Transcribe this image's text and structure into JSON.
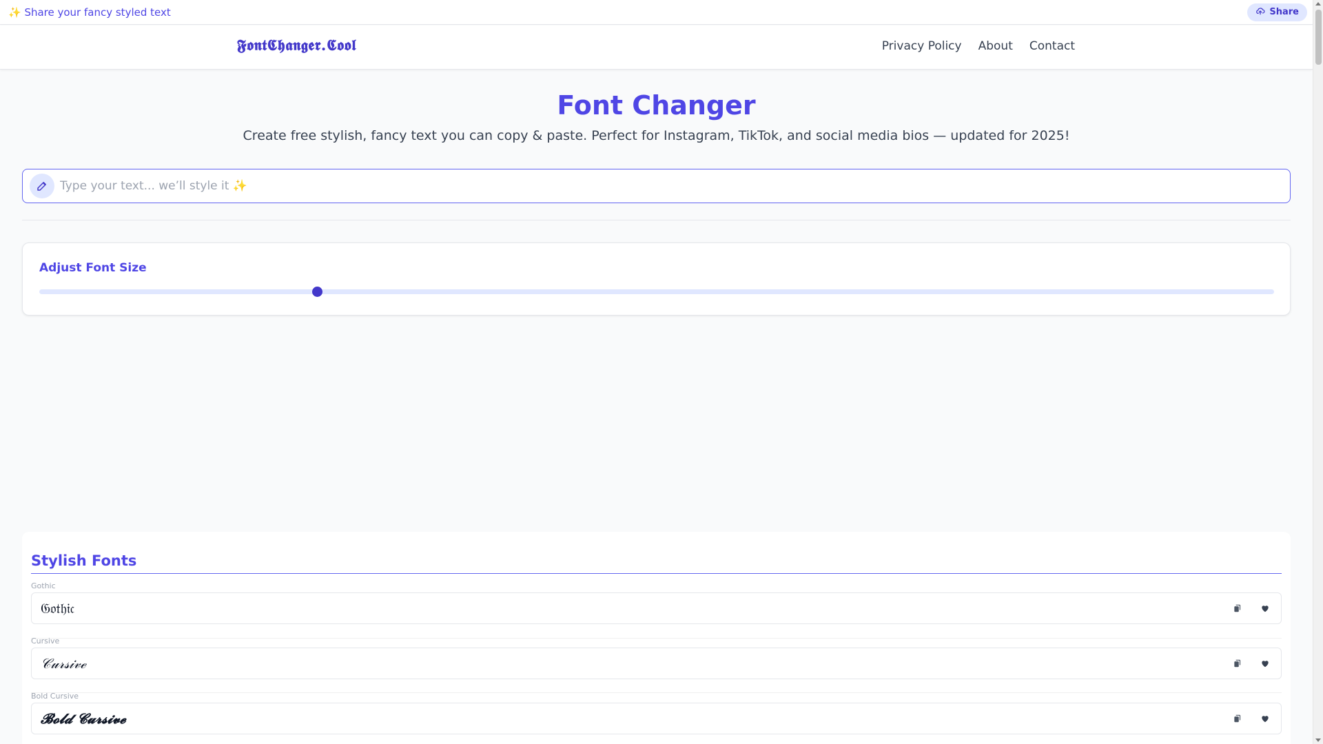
{
  "topbar": {
    "share_text": "✨ Share your fancy styled text",
    "share_button": "Share"
  },
  "header": {
    "logo": "𝕱𝖔𝖓𝖙𝕮𝖍𝖆𝖓𝖌𝖊𝖗.𝕮𝖔𝖔𝖑",
    "nav": [
      "Privacy Policy",
      "About",
      "Contact"
    ]
  },
  "hero": {
    "title": "Font Changer",
    "subtitle": "Create free stylish, fancy text you can copy & paste. Perfect for Instagram, TikTok, and social media bios — updated for 2025!"
  },
  "input": {
    "placeholder": "Type your text... we’ll style it ✨",
    "value": ""
  },
  "font_size": {
    "label": "Adjust Font Size",
    "slider_fraction": 0.225
  },
  "fonts_section": {
    "title": "Stylish Fonts",
    "items": [
      {
        "name": "Gothic",
        "preview": "𝔊𝔬𝔱𝔥𝔦𝔠"
      },
      {
        "name": "Cursive",
        "preview": "𝒞𝓊𝓇𝓈𝒾𝓋ℯ"
      },
      {
        "name": "Bold Cursive",
        "preview": "𝓑𝓸𝓵𝓭 𝓒𝓾𝓻𝓼𝓲𝓿𝓮"
      }
    ]
  },
  "icons": {
    "share": "cloud-upload-icon",
    "input": "pencil-icon",
    "copy": "copy-icon",
    "favorite": "heart-icon"
  },
  "colors": {
    "accent": "#4f46e5",
    "accent_dark": "#4338ca",
    "accent_light": "#e0e7ff",
    "background": "#f9fafb"
  }
}
